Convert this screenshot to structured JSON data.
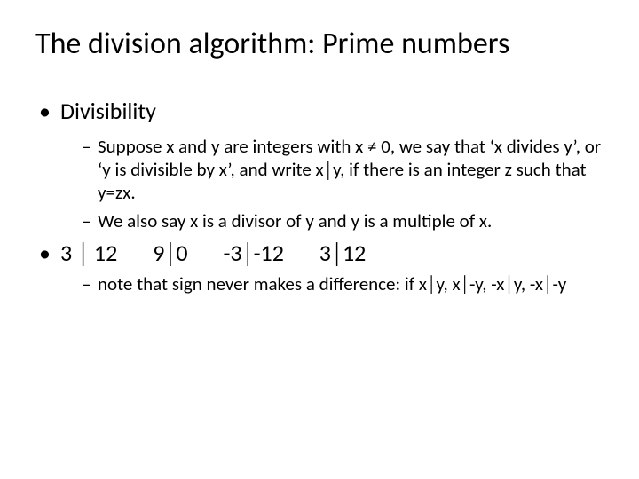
{
  "title": "The division algorithm: Prime numbers",
  "bullets": {
    "divisibility_label": "Divisibility",
    "sub1": "Suppose x and y are integers with x ≠ 0, we say that ‘x divides y’, or ‘y is divisible by x’, and write x│y, if there is an integer z such that y=zx.",
    "sub2": "We also say x is a divisor of y and y is a multiple of x.",
    "examples": {
      "e1": "3 │ 12",
      "e2": "9│0",
      "e3": "-3│-12",
      "e4": "3│12"
    },
    "note": "note that sign never makes a difference: if x│y, x│-y, -x│y, -x│-y"
  }
}
